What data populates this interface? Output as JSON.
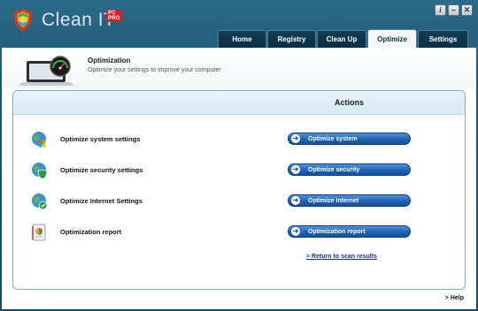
{
  "app": {
    "name": "Clean IT",
    "badge": "PC PRO",
    "window_buttons": [
      "i",
      "–",
      "✕"
    ]
  },
  "tabs": [
    {
      "label": "Home",
      "active": false
    },
    {
      "label": "Registry",
      "active": false
    },
    {
      "label": "Clean Up",
      "active": false
    },
    {
      "label": "Optimize",
      "active": true
    },
    {
      "label": "Settings",
      "active": false
    }
  ],
  "header": {
    "title": "Optimization",
    "subtitle": "Optimize your settings to improve your computer"
  },
  "actions": {
    "title": "Actions",
    "rows": [
      {
        "label": "Optimize system settings",
        "button": "Optimize system",
        "icon": "globe-windows-icon"
      },
      {
        "label": "Optimize security settings",
        "button": "Optimize security",
        "icon": "globe-shield-icon"
      },
      {
        "label": "Optimize Internet Settings",
        "button": "Optimize Internet",
        "icon": "globe-internet-icon"
      },
      {
        "label": "Optimization report",
        "button": "Optimization report",
        "icon": "report-icon"
      }
    ],
    "return_link": "> Return to scan results"
  },
  "help": "> Help",
  "colors": {
    "frame": "#1d5572",
    "button": "#1f62b4",
    "link": "#10329a"
  }
}
